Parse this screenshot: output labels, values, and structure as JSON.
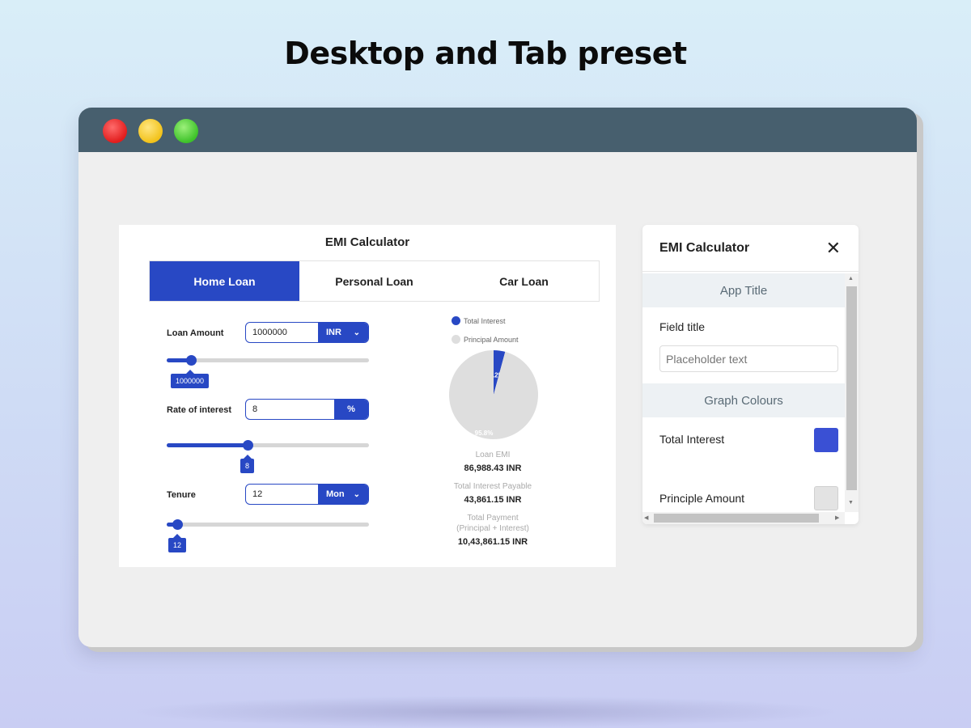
{
  "page": {
    "headline": "Desktop and Tab preset"
  },
  "window": {
    "controls": [
      "close-dot",
      "minimize-dot",
      "maximize-dot"
    ]
  },
  "emi": {
    "title": "EMI Calculator",
    "tabs": [
      {
        "label": "Home Loan",
        "active": true
      },
      {
        "label": "Personal Loan",
        "active": false
      },
      {
        "label": "Car Loan",
        "active": false
      }
    ],
    "loan_amount": {
      "label": "Loan Amount",
      "value": "1000000",
      "unit": "INR",
      "slider_fraction": 0.12,
      "tooltip": "1000000"
    },
    "rate": {
      "label": "Rate of interest",
      "value": "8",
      "unit": "%",
      "slider_fraction": 0.4,
      "tooltip": "8"
    },
    "tenure": {
      "label": "Tenure",
      "value": "12",
      "unit": "Mon",
      "slider_fraction": 0.05,
      "tooltip": "12"
    },
    "legend": {
      "interest": "Total Interest",
      "principal": "Principal Amount"
    },
    "summary": {
      "emi_label": "Loan EMI",
      "emi_value": "86,988.43 INR",
      "interest_label": "Total Interest Payable",
      "interest_value": "43,861.15 INR",
      "payment_label_1": "Total Payment",
      "payment_label_2": "(Principal + Interest)",
      "payment_value": "10,43,861.15 INR"
    },
    "colors": {
      "interest": "#2848c4",
      "principal": "#dedede"
    }
  },
  "chart_data": {
    "type": "pie",
    "categories": [
      "Total Interest",
      "Principal Amount"
    ],
    "values": [
      4.2,
      95.8
    ],
    "labels": [
      "4.2%",
      "95.8%"
    ],
    "colors": [
      "#2848c4",
      "#dedede"
    ]
  },
  "panel": {
    "title": "EMI Calculator",
    "close": "✕",
    "section_app": "App Title",
    "field_label": "Field title",
    "field_placeholder": "Placeholder text",
    "section_graph": "Graph Colours",
    "interest_label": "Total Interest",
    "interest_color": "#3a50d4",
    "principal_label": "Principle Amount",
    "principal_color": "#e3e3e3"
  }
}
